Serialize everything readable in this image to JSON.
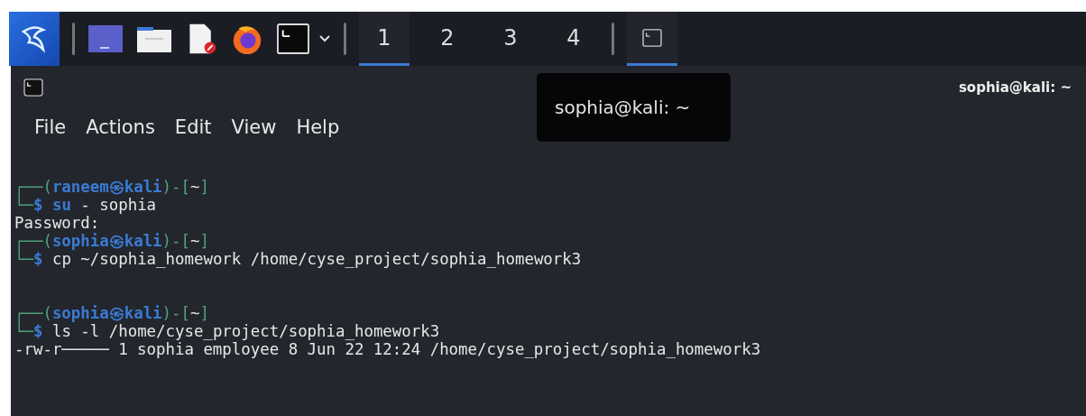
{
  "taskbar": {
    "launchers": [
      {
        "kind": "desktop"
      },
      {
        "kind": "files"
      },
      {
        "kind": "document"
      },
      {
        "kind": "browser"
      },
      {
        "kind": "terminal"
      }
    ],
    "workspaces": [
      {
        "label": "1",
        "selected": true
      },
      {
        "label": "2",
        "selected": false
      },
      {
        "label": "3",
        "selected": false
      },
      {
        "label": "4",
        "selected": false
      }
    ],
    "tasks": [
      {
        "selected": true
      }
    ]
  },
  "tooltip": {
    "text": "sophia@kali: ~"
  },
  "window": {
    "title": "sophia@kali: ~"
  },
  "menu": [
    "File",
    "Actions",
    "Edit",
    "View",
    "Help"
  ],
  "lines": [
    {
      "kind": "prompt",
      "parts": [
        {
          "kind": "frame",
          "text": "┌──("
        },
        {
          "kind": "user",
          "text": "raneem㉿kali"
        },
        {
          "kind": "frame",
          "text": ")-["
        },
        {
          "kind": "dir",
          "text": "~"
        },
        {
          "kind": "frame",
          "text": "]"
        }
      ]
    },
    {
      "kind": "command",
      "parts": [
        {
          "kind": "frame",
          "text": "└─"
        },
        {
          "kind": "user",
          "text": "$ "
        },
        {
          "kind": "cmd",
          "text": "su"
        },
        {
          "kind": "plain",
          "text": " - sophia"
        }
      ]
    },
    {
      "kind": "output",
      "parts": [
        {
          "kind": "plain",
          "text": "Password:"
        }
      ]
    },
    {
      "kind": "prompt",
      "parts": [
        {
          "kind": "frame",
          "text": "┌──("
        },
        {
          "kind": "user",
          "text": "sophia㉿kali"
        },
        {
          "kind": "frame",
          "text": ")-["
        },
        {
          "kind": "dir",
          "text": "~"
        },
        {
          "kind": "frame",
          "text": "]"
        }
      ]
    },
    {
      "kind": "command",
      "parts": [
        {
          "kind": "frame",
          "text": "└─"
        },
        {
          "kind": "user",
          "text": "$ "
        },
        {
          "kind": "plain",
          "text": "cp ~/sophia_homework /home/cyse_project/sophia_homework3"
        }
      ]
    },
    {
      "kind": "blank"
    },
    {
      "kind": "prompt",
      "parts": [
        {
          "kind": "frame",
          "text": "┌──("
        },
        {
          "kind": "user",
          "text": "sophia㉿kali"
        },
        {
          "kind": "frame",
          "text": ")-["
        },
        {
          "kind": "dir",
          "text": "~"
        },
        {
          "kind": "frame",
          "text": "]"
        }
      ]
    },
    {
      "kind": "command",
      "parts": [
        {
          "kind": "frame",
          "text": "└─"
        },
        {
          "kind": "user",
          "text": "$ "
        },
        {
          "kind": "plain",
          "text": "ls -l /home/cyse_project/sophia_homework3"
        }
      ]
    },
    {
      "kind": "output",
      "parts": [
        {
          "kind": "plain",
          "text": "-rw-r───── 1 sophia employee 8 Jun 22 12:24 /home/cyse_project/sophia_homework3"
        }
      ]
    }
  ]
}
